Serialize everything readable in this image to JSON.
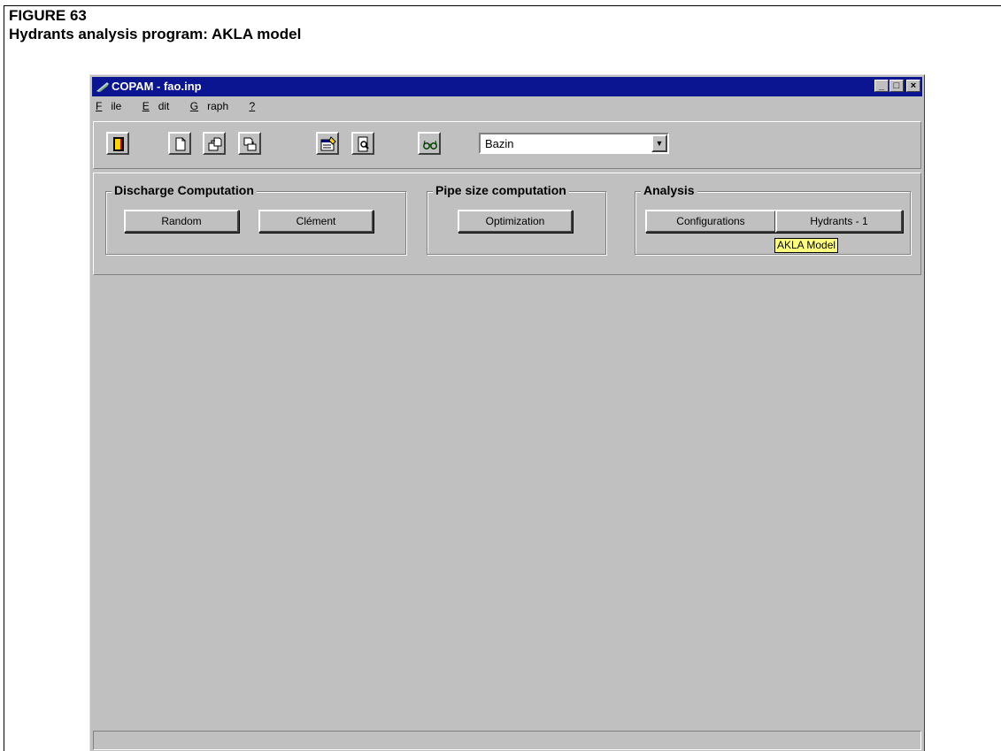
{
  "figure": {
    "number": "FIGURE 63",
    "title": "Hydrants analysis program: AKLA model"
  },
  "window": {
    "title": "COPAM - fao.inp",
    "controls": [
      "_",
      "□",
      "×"
    ]
  },
  "menu": {
    "items": [
      {
        "label": "File",
        "underline": "F",
        "rest": "ile"
      },
      {
        "label": "Edit",
        "underline": "E",
        "rest": "dit"
      },
      {
        "label": "Graph",
        "underline": "G",
        "rest": "raph"
      },
      {
        "label": "?",
        "underline": "?",
        "rest": ""
      }
    ]
  },
  "toolbar": {
    "icons": [
      "exit-icon",
      "new-file-icon",
      "open-file-icon",
      "save-file-icon",
      "edit-data-icon",
      "print-preview-icon",
      "glasses-icon"
    ],
    "formula_select": {
      "value": "Bazin",
      "arrow": "▼"
    }
  },
  "groups": {
    "discharge": {
      "title": "Discharge Computation",
      "random_label": "Random",
      "clement_label": "Clément"
    },
    "pipe_size": {
      "title": "Pipe size computation",
      "optimization_label": "Optimization"
    },
    "analysis": {
      "title": "Analysis",
      "configurations_label": "Configurations",
      "hydrants_label": "Hydrants - 1",
      "tooltip": "AKLA Model"
    }
  },
  "colors": {
    "titlebar": "#0b1592",
    "face": "#c0c0c0",
    "tooltip": "#ffff80"
  }
}
